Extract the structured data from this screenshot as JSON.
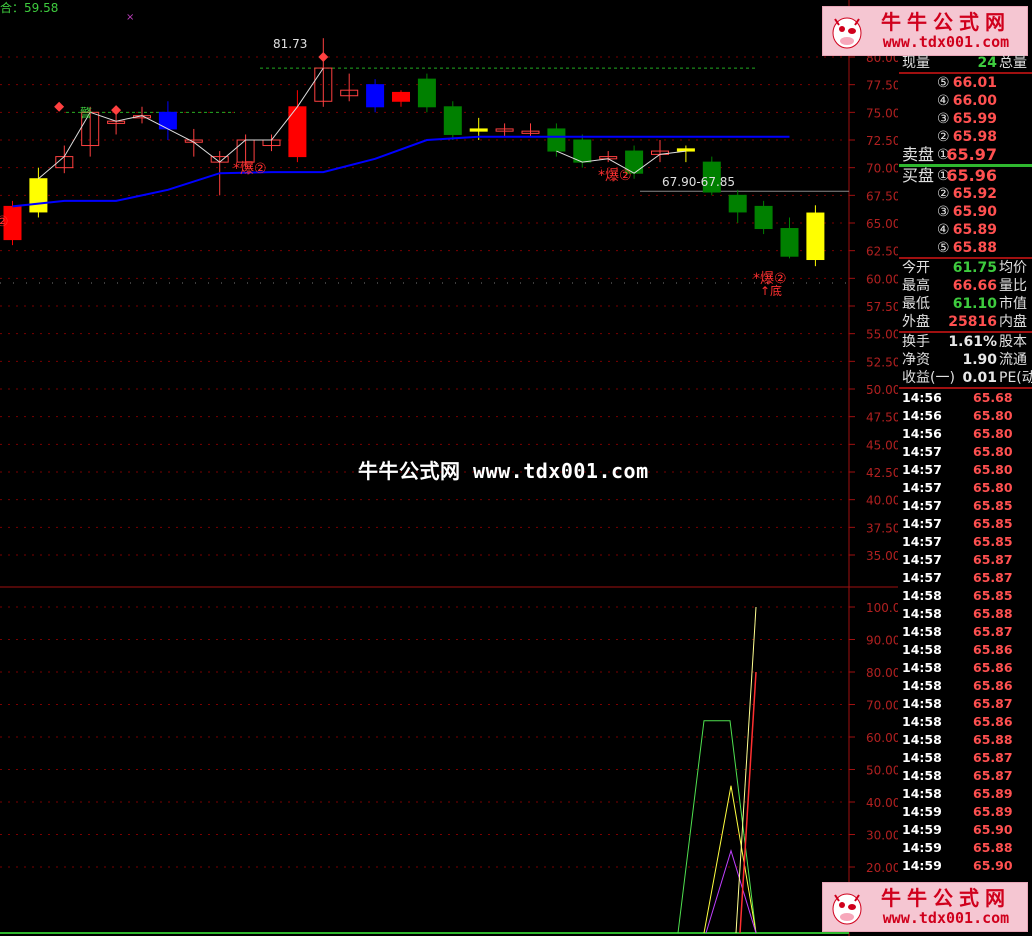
{
  "chart": {
    "top_left_label": "合：59.58",
    "peak_label": "81.73",
    "range_label": "67.90-67.85",
    "signal_warn": "警",
    "signal_burst_1": "*爆②",
    "signal_burst_2": "*爆②",
    "signal_burst_3": "*爆②",
    "signal_burst_4": "②",
    "signal_bottom": "↑底",
    "watermark_center": "牛牛公式网 www.tdx001.com",
    "price_axis": [
      "80.00",
      "77.50",
      "75.00",
      "72.50",
      "70.00",
      "67.50",
      "65.00",
      "62.50",
      "60.00",
      "57.50",
      "55.00",
      "52.50",
      "50.00",
      "47.50",
      "45.00",
      "42.50",
      "40.00",
      "37.50",
      "35.00"
    ],
    "indicator_axis": [
      "100.0",
      "90.00",
      "80.00",
      "70.00",
      "60.00",
      "50.00",
      "40.00",
      "30.00",
      "20.00"
    ],
    "colors": {
      "up": "#ff0000",
      "down": "#008000",
      "blue": "#0000ff",
      "yellow": "#ffff00",
      "ma": "#0000ff",
      "grid": "#7a0000"
    }
  },
  "badge": {
    "line1": "牛牛公式网",
    "line2": "www.tdx001.com"
  },
  "quote": {
    "current": {
      "label": "现量",
      "value": "24",
      "right": "总量"
    },
    "ask": [
      {
        "level": "⑤",
        "price": "66.01"
      },
      {
        "level": "④",
        "price": "66.00"
      },
      {
        "level": "③",
        "price": "65.99"
      },
      {
        "level": "②",
        "price": "65.98"
      }
    ],
    "ask1": {
      "label": "卖盘",
      "level": "①",
      "price": "65.97"
    },
    "bid1": {
      "label": "买盘",
      "level": "①",
      "price": "65.96"
    },
    "bid": [
      {
        "level": "②",
        "price": "65.92"
      },
      {
        "level": "③",
        "price": "65.90"
      },
      {
        "level": "④",
        "price": "65.89"
      },
      {
        "level": "⑤",
        "price": "65.88"
      }
    ],
    "stats1": [
      {
        "label": "今开",
        "value": "61.75",
        "color": "green",
        "right": "均价"
      },
      {
        "label": "最高",
        "value": "66.66",
        "color": "red",
        "right": "量比"
      },
      {
        "label": "最低",
        "value": "61.10",
        "color": "green",
        "right": "市值"
      },
      {
        "label": "外盘",
        "value": "25816",
        "color": "red",
        "right": "内盘"
      }
    ],
    "stats2": [
      {
        "label": "换手",
        "value": "1.61%",
        "color": "white",
        "right": "股本"
      },
      {
        "label": "净资",
        "value": "1.90",
        "color": "white",
        "right": "流通"
      },
      {
        "label": "收益(一)",
        "value": "0.01",
        "color": "white",
        "right": "PE(动"
      }
    ]
  },
  "ticks": [
    {
      "time": "14:56",
      "price": "65.68"
    },
    {
      "time": "14:56",
      "price": "65.80"
    },
    {
      "time": "14:56",
      "price": "65.80"
    },
    {
      "time": "14:57",
      "price": "65.80"
    },
    {
      "time": "14:57",
      "price": "65.80"
    },
    {
      "time": "14:57",
      "price": "65.80"
    },
    {
      "time": "14:57",
      "price": "65.85"
    },
    {
      "time": "14:57",
      "price": "65.85"
    },
    {
      "time": "14:57",
      "price": "65.85"
    },
    {
      "time": "14:57",
      "price": "65.87"
    },
    {
      "time": "14:57",
      "price": "65.87"
    },
    {
      "time": "14:58",
      "price": "65.85"
    },
    {
      "time": "14:58",
      "price": "65.88"
    },
    {
      "time": "14:58",
      "price": "65.87"
    },
    {
      "time": "14:58",
      "price": "65.86"
    },
    {
      "time": "14:58",
      "price": "65.86"
    },
    {
      "time": "14:58",
      "price": "65.86"
    },
    {
      "time": "14:58",
      "price": "65.87"
    },
    {
      "time": "14:58",
      "price": "65.86"
    },
    {
      "time": "14:58",
      "price": "65.88"
    },
    {
      "time": "14:58",
      "price": "65.87"
    },
    {
      "time": "14:58",
      "price": "65.87"
    },
    {
      "time": "14:58",
      "price": "65.89"
    },
    {
      "time": "14:59",
      "price": "65.89"
    },
    {
      "time": "14:59",
      "price": "65.90"
    },
    {
      "time": "14:59",
      "price": "65.88"
    },
    {
      "time": "14:59",
      "price": "65.90"
    }
  ],
  "candles": [
    {
      "o": 63.5,
      "c": 66.5,
      "h": 67.0,
      "l": 63.0,
      "kind": "up"
    },
    {
      "o": 66.0,
      "c": 69.0,
      "h": 70.0,
      "l": 65.5,
      "kind": "yellow"
    },
    {
      "o": 70.0,
      "c": 71.0,
      "h": 72.0,
      "l": 69.5,
      "kind": "hollow"
    },
    {
      "o": 72.0,
      "c": 75.0,
      "h": 75.5,
      "l": 71.0,
      "kind": "hollow"
    },
    {
      "o": 74.0,
      "c": 74.2,
      "h": 75.5,
      "l": 73.0,
      "kind": "hollow"
    },
    {
      "o": 74.5,
      "c": 74.7,
      "h": 75.5,
      "l": 74.0,
      "kind": "hollow"
    },
    {
      "o": 75.0,
      "c": 73.5,
      "h": 76.0,
      "l": 72.5,
      "kind": "blue"
    },
    {
      "o": 72.5,
      "c": 72.3,
      "h": 73.5,
      "l": 71.0,
      "kind": "hollow"
    },
    {
      "o": 71.0,
      "c": 70.5,
      "h": 71.5,
      "l": 67.5,
      "kind": "hollow"
    },
    {
      "o": 70.5,
      "c": 72.5,
      "h": 73.0,
      "l": 70.0,
      "kind": "hollow"
    },
    {
      "o": 72.0,
      "c": 72.5,
      "h": 73.0,
      "l": 71.5,
      "kind": "hollow"
    },
    {
      "o": 71.0,
      "c": 75.5,
      "h": 77.0,
      "l": 70.5,
      "kind": "up"
    },
    {
      "o": 76.0,
      "c": 79.0,
      "h": 81.7,
      "l": 75.5,
      "kind": "hollow"
    },
    {
      "o": 76.5,
      "c": 77.0,
      "h": 78.5,
      "l": 76.0,
      "kind": "hollow"
    },
    {
      "o": 77.5,
      "c": 75.5,
      "h": 78.0,
      "l": 75.0,
      "kind": "blue"
    },
    {
      "o": 76.0,
      "c": 76.8,
      "h": 77.0,
      "l": 75.5,
      "kind": "up"
    },
    {
      "o": 78.0,
      "c": 75.5,
      "h": 78.5,
      "l": 75.0,
      "kind": "down"
    },
    {
      "o": 75.5,
      "c": 73.0,
      "h": 76.0,
      "l": 72.5,
      "kind": "down"
    },
    {
      "o": 73.5,
      "c": 73.3,
      "h": 74.5,
      "l": 72.5,
      "kind": "yellow"
    },
    {
      "o": 73.5,
      "c": 73.3,
      "h": 74.0,
      "l": 72.8,
      "kind": "hollow"
    },
    {
      "o": 73.3,
      "c": 73.1,
      "h": 74.0,
      "l": 72.8,
      "kind": "hollow"
    },
    {
      "o": 73.5,
      "c": 71.5,
      "h": 74.0,
      "l": 71.0,
      "kind": "down"
    },
    {
      "o": 72.5,
      "c": 70.5,
      "h": 73.0,
      "l": 70.0,
      "kind": "down"
    },
    {
      "o": 71.0,
      "c": 70.8,
      "h": 71.5,
      "l": 70.5,
      "kind": "hollow"
    },
    {
      "o": 71.5,
      "c": 69.5,
      "h": 72.0,
      "l": 69.0,
      "kind": "down"
    },
    {
      "o": 71.5,
      "c": 71.2,
      "h": 72.5,
      "l": 70.5,
      "kind": "hollow"
    },
    {
      "o": 71.7,
      "c": 71.5,
      "h": 72.0,
      "l": 70.5,
      "kind": "yellow"
    },
    {
      "o": 70.5,
      "c": 67.8,
      "h": 71.0,
      "l": 67.5,
      "kind": "down"
    },
    {
      "o": 67.5,
      "c": 66.0,
      "h": 68.0,
      "l": 65.0,
      "kind": "down"
    },
    {
      "o": 66.5,
      "c": 64.5,
      "h": 67.0,
      "l": 64.0,
      "kind": "down"
    },
    {
      "o": 64.5,
      "c": 62.0,
      "h": 65.5,
      "l": 61.8,
      "kind": "down"
    },
    {
      "o": 61.7,
      "c": 65.9,
      "h": 66.6,
      "l": 61.1,
      "kind": "yellow"
    }
  ],
  "ma_line": [
    [
      0,
      66.5
    ],
    [
      2,
      67.0
    ],
    [
      4,
      67.0
    ],
    [
      6,
      68.0
    ],
    [
      8,
      69.5
    ],
    [
      10,
      69.6
    ],
    [
      12,
      69.6
    ],
    [
      14,
      70.8
    ],
    [
      16,
      72.5
    ],
    [
      18,
      72.8
    ],
    [
      22,
      72.8
    ],
    [
      26,
      72.8
    ],
    [
      30,
      72.8
    ]
  ]
}
